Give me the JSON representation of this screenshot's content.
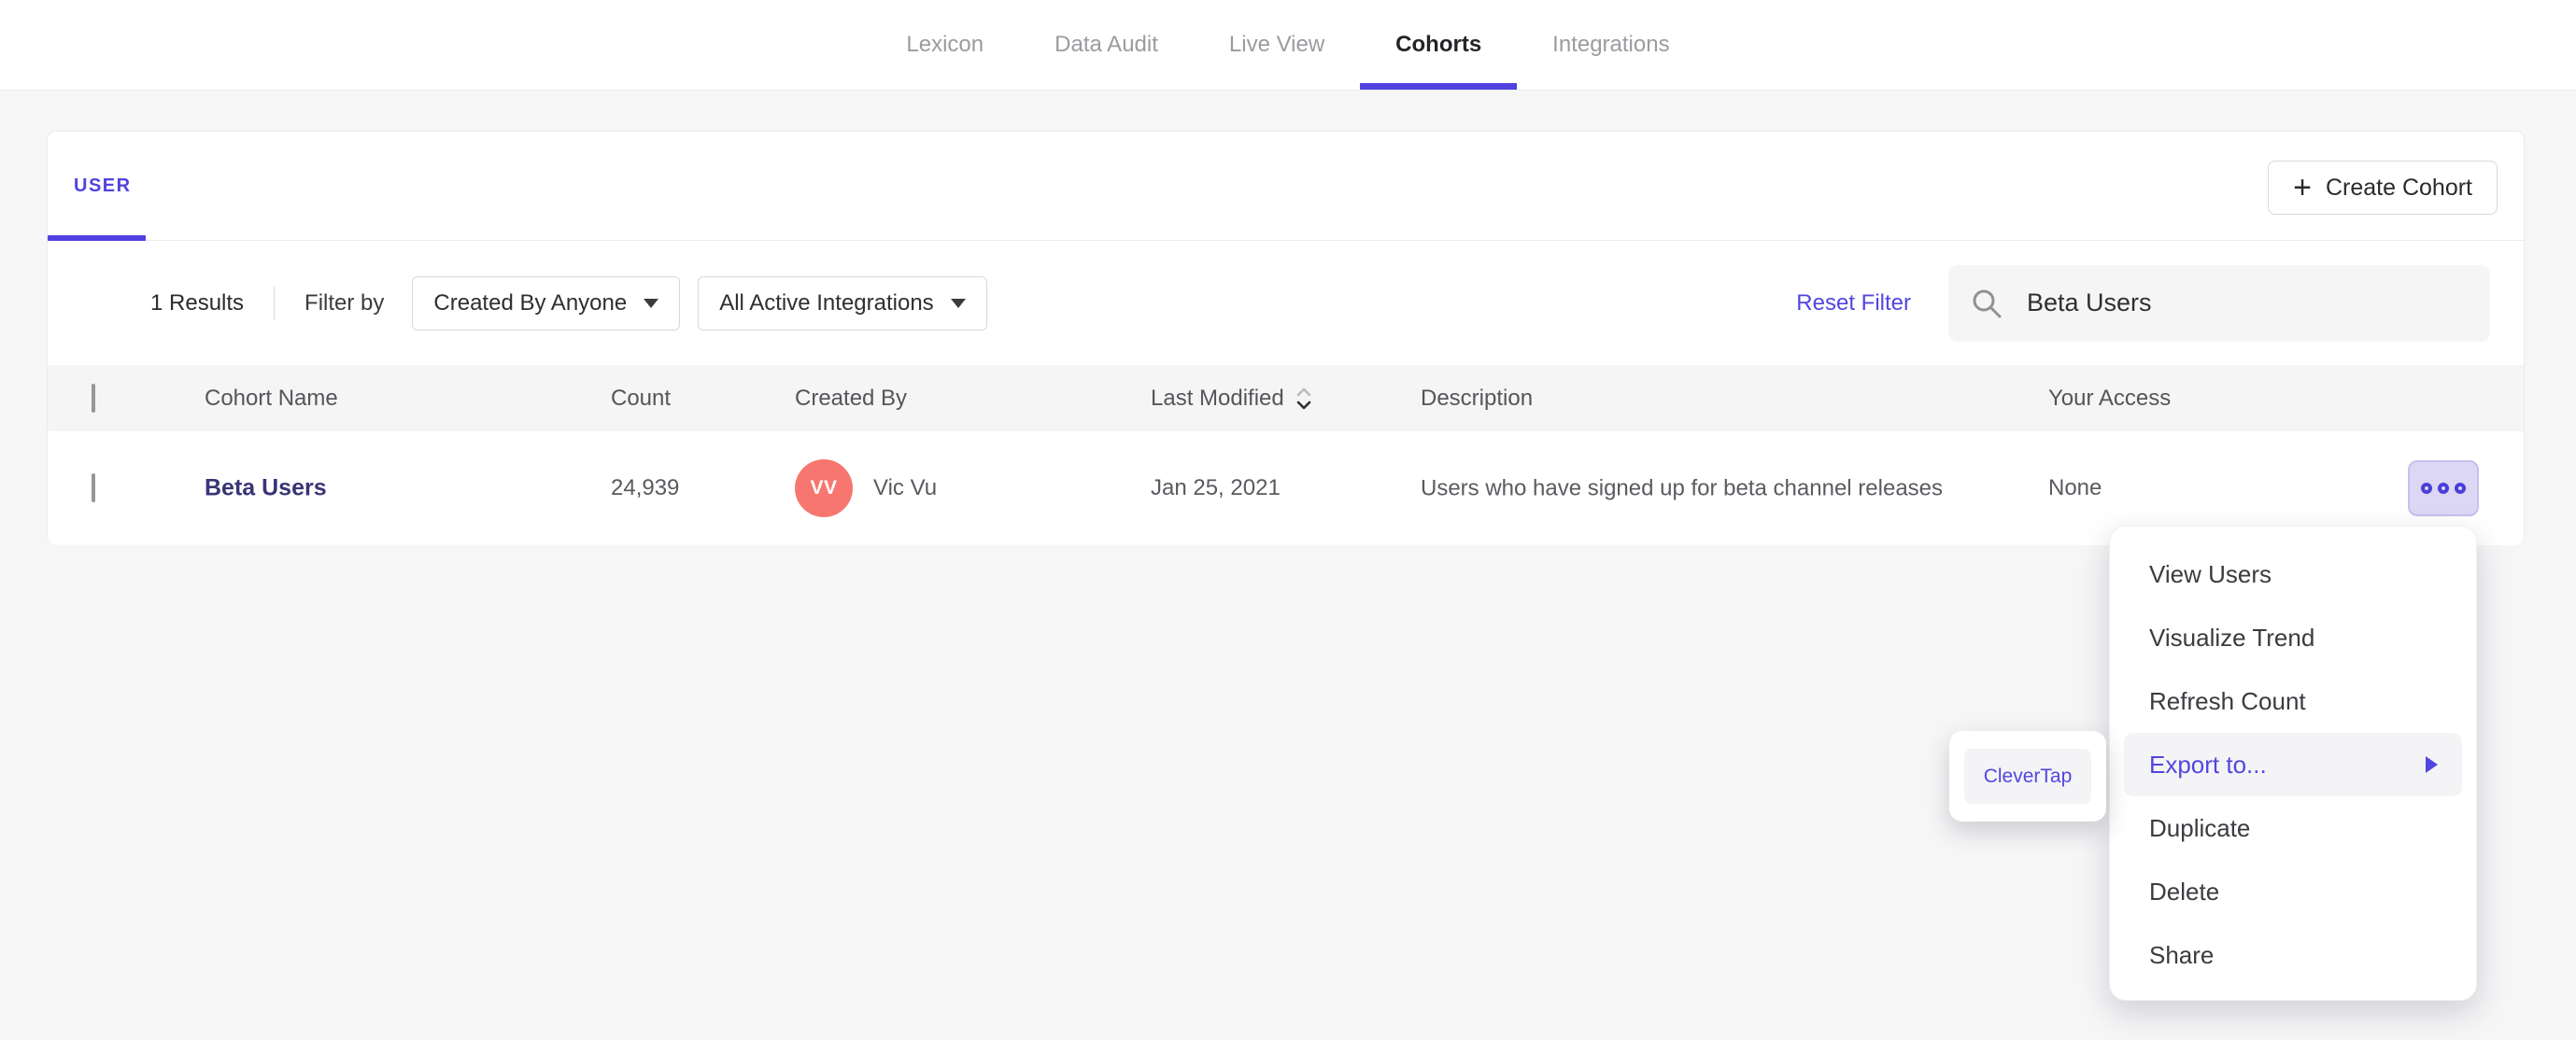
{
  "nav": {
    "tabs": [
      {
        "label": "Lexicon",
        "active": false
      },
      {
        "label": "Data Audit",
        "active": false
      },
      {
        "label": "Live View",
        "active": false
      },
      {
        "label": "Cohorts",
        "active": true
      },
      {
        "label": "Integrations",
        "active": false
      }
    ]
  },
  "card": {
    "user_tab_label": "USER",
    "create_button": {
      "plus": "+",
      "label": "Create Cohort"
    }
  },
  "filter": {
    "results_label": "1 Results",
    "filter_by_label": "Filter by",
    "created_by_dropdown": {
      "value": "Created By Anyone"
    },
    "integrations_dropdown": {
      "value": "All Active Integrations"
    },
    "reset_label": "Reset Filter",
    "search": {
      "value": "Beta Users"
    }
  },
  "table": {
    "headers": [
      "Cohort Name",
      "Count",
      "Created By",
      "Last Modified",
      "Description",
      "Your Access"
    ],
    "rows": [
      {
        "name": "Beta Users",
        "count": "24,939",
        "avatar_initials": "VV",
        "created_by": "Vic Vu",
        "last_modified": "Jan 25, 2021",
        "description": "Users who have signed up for beta channel releases",
        "access": "None"
      }
    ]
  },
  "context_menu": {
    "items": [
      "View Users",
      "Visualize Trend",
      "Refresh Count",
      "Export to...",
      "Duplicate",
      "Delete",
      "Share"
    ],
    "highlighted_item": "Export to..."
  },
  "export_submenu": {
    "items": [
      "CleverTap"
    ]
  },
  "colors": {
    "accent_purple": "#5246e0",
    "active_underline": "#4f42e0",
    "cohort_link": "#3a3476",
    "avatar_bg": "#f7766f",
    "more_button_bg": "#dbd7f4",
    "menu_highlight_bg": "#f4f4f6",
    "header_row_bg": "#f5f5f6",
    "page_bg": "#f6f6f7"
  }
}
